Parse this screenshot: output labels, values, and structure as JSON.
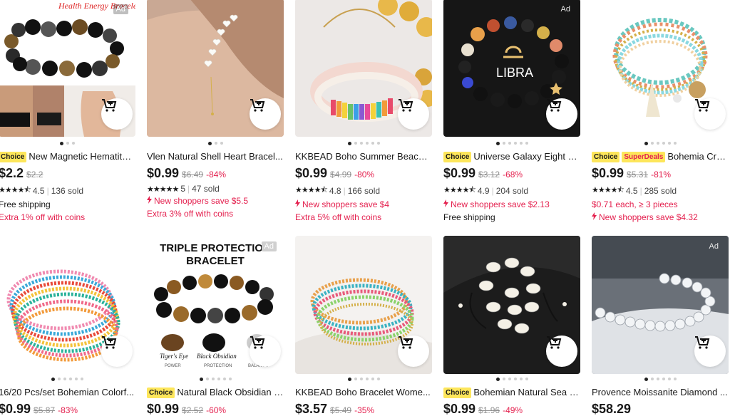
{
  "cards": [
    {
      "ad": "Ad",
      "choice": "Choice",
      "superdeals": "",
      "title": "New Magnetic Hematite ...",
      "price": "$2.2",
      "orig": "$2.2",
      "disc": "",
      "rating": "4.5",
      "sold": "136 sold",
      "line1": "Free shipping",
      "line2": "Extra 1% off with coins",
      "image_text": "Health Energy Bracelet"
    },
    {
      "ad": "",
      "choice": "",
      "superdeals": "",
      "title": "Vlen Natural Shell Heart Bracel...",
      "price": "$0.99",
      "orig": "$6.49",
      "disc": "-84%",
      "rating": "5",
      "sold": "47 sold",
      "line1": "New shoppers save $5.5",
      "line2": "Extra 3% off with coins"
    },
    {
      "ad": "",
      "choice": "",
      "superdeals": "",
      "title": "KKBEAD Boho Summer Beach ...",
      "price": "$0.99",
      "orig": "$4.99",
      "disc": "-80%",
      "rating": "4.8",
      "sold": "166 sold",
      "line1": "New shoppers save $4",
      "line2": "Extra 5% off with coins"
    },
    {
      "ad": "Ad",
      "choice": "Choice",
      "superdeals": "",
      "title": "Universe Galaxy Eight Pl...",
      "price": "$0.99",
      "orig": "$3.12",
      "disc": "-68%",
      "rating": "4.9",
      "sold": "204 sold",
      "line1": "New shoppers save $2.13",
      "line2": "Free shipping",
      "image_text": "LIBRA"
    },
    {
      "ad": "",
      "choice": "Choice",
      "superdeals": "SuperDeals",
      "title": "Bohemia Cryst...",
      "price": "$0.99",
      "orig": "$5.31",
      "disc": "-81%",
      "rating": "4.5",
      "sold": "285 sold",
      "line1": "$0.71 each, ≥ 3 pieces",
      "line2": "New shoppers save $4.32"
    },
    {
      "ad": "",
      "choice": "",
      "superdeals": "",
      "title": "16/20 Pcs/set Bohemian Colorf...",
      "price": "$0.99",
      "orig": "$5.87",
      "disc": "-83%"
    },
    {
      "ad": "Ad",
      "choice": "Choice",
      "superdeals": "",
      "title": "Natural Black Obsidian H...",
      "price": "$0.99",
      "orig": "$2.52",
      "disc": "-60%",
      "image_text": "TRIPLE PROTECTION BRACELET",
      "caption1": "Tiger's Eye",
      "caption1b": "POWER",
      "caption2": "Black Obsidian",
      "caption2b": "PROTECTION",
      "caption3b": "BALANCE"
    },
    {
      "ad": "",
      "choice": "",
      "superdeals": "",
      "title": "KKBEAD Boho Bracelet Wome...",
      "price": "$3.57",
      "orig": "$5.49",
      "disc": "-35%"
    },
    {
      "ad": "",
      "choice": "Choice",
      "superdeals": "",
      "title": "Bohemian Natural Sea Sh...",
      "price": "$0.99",
      "orig": "$1.96",
      "disc": "-49%"
    },
    {
      "ad": "Ad",
      "choice": "",
      "superdeals": "",
      "title": "Provence Moissanite Diamond ...",
      "price": "$58.29",
      "orig": "",
      "disc": ""
    }
  ],
  "colors": {
    "accent_red": "#e4214f",
    "choice_yellow": "#fde65b"
  },
  "icons": {
    "cart": "add-to-cart-icon",
    "flash": "lightning-icon",
    "star": "star-icon"
  }
}
